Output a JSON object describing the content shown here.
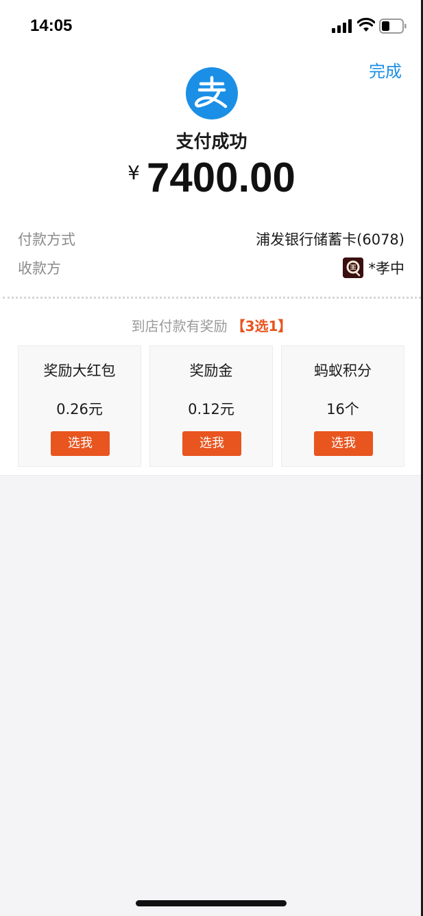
{
  "status_bar": {
    "time": "14:05",
    "icons": [
      "signal-icon",
      "wifi-icon",
      "battery-icon"
    ]
  },
  "header": {
    "done_label": "完成",
    "logo_icon": "alipay-logo",
    "logo_color": "#1b8fe6"
  },
  "payment": {
    "status": "支付成功",
    "currency": "¥",
    "amount": "7400.00"
  },
  "details": [
    {
      "label": "付款方式",
      "value": "浦发银行储蓄卡(6078)"
    },
    {
      "label": "收款方",
      "value": "*孝中"
    }
  ],
  "rewards": {
    "heading": "到店付款有奖励",
    "tag": "【3选1】",
    "accent_color": "#e8551f",
    "options": [
      {
        "name": "奖励大红包",
        "value": "0.26元",
        "button": "选我"
      },
      {
        "name": "奖励金",
        "value": "0.12元",
        "button": "选我"
      },
      {
        "name": "蚂蚁积分",
        "value": "16个",
        "button": "选我"
      }
    ]
  }
}
